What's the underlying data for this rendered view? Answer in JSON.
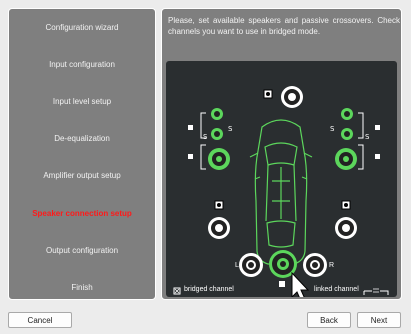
{
  "steps": [
    {
      "label": "Configuration wizard",
      "active": false
    },
    {
      "label": "Input configuration",
      "active": false
    },
    {
      "label": "Input level setup",
      "active": false
    },
    {
      "label": "De-equalization",
      "active": false
    },
    {
      "label": "Amplifier output setup",
      "active": false
    },
    {
      "label": "Speaker connection setup",
      "active": true
    },
    {
      "label": "Output configuration",
      "active": false
    },
    {
      "label": "Finish",
      "active": false
    }
  ],
  "instructions": "Please, set available speakers and passive crossovers. Check channels you want to use in bridged mode.",
  "diagram": {
    "center_left_label": "L",
    "center_right_label": "R",
    "legend_bridged": "bridged channel",
    "legend_linked": "linked channel",
    "colors": {
      "active": "#5cd65c",
      "inactive": "#ffffff",
      "accent": "#ff1a1a"
    }
  },
  "buttons": {
    "cancel": "Cancel",
    "back": "Back",
    "next": "Next"
  }
}
